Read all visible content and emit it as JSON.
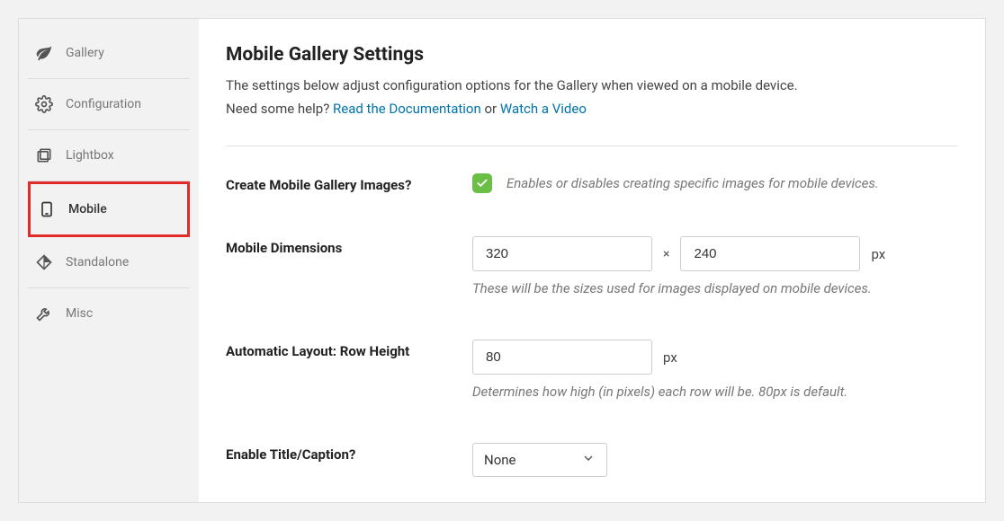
{
  "sidebar": {
    "items": [
      {
        "label": "Gallery"
      },
      {
        "label": "Configuration"
      },
      {
        "label": "Lightbox"
      },
      {
        "label": "Mobile"
      },
      {
        "label": "Standalone"
      },
      {
        "label": "Misc"
      }
    ]
  },
  "header": {
    "title": "Mobile Gallery Settings",
    "desc_line1": "The settings below adjust configuration options for the Gallery when viewed on a mobile device.",
    "help_prefix": "Need some help? ",
    "link_docs": "Read the Documentation",
    "or_text": " or ",
    "link_video": "Watch a Video"
  },
  "fields": {
    "create_images": {
      "label": "Create Mobile Gallery Images?",
      "hint": "Enables or disables creating specific images for mobile devices."
    },
    "dimensions": {
      "label": "Mobile Dimensions",
      "width": "320",
      "height": "240",
      "times": "×",
      "unit": "px",
      "hint": "These will be the sizes used for images displayed on mobile devices."
    },
    "row_height": {
      "label": "Automatic Layout: Row Height",
      "value": "80",
      "unit": "px",
      "hint": "Determines how high (in pixels) each row will be. 80px is default."
    },
    "title_caption": {
      "label": "Enable Title/Caption?",
      "value": "None"
    }
  }
}
